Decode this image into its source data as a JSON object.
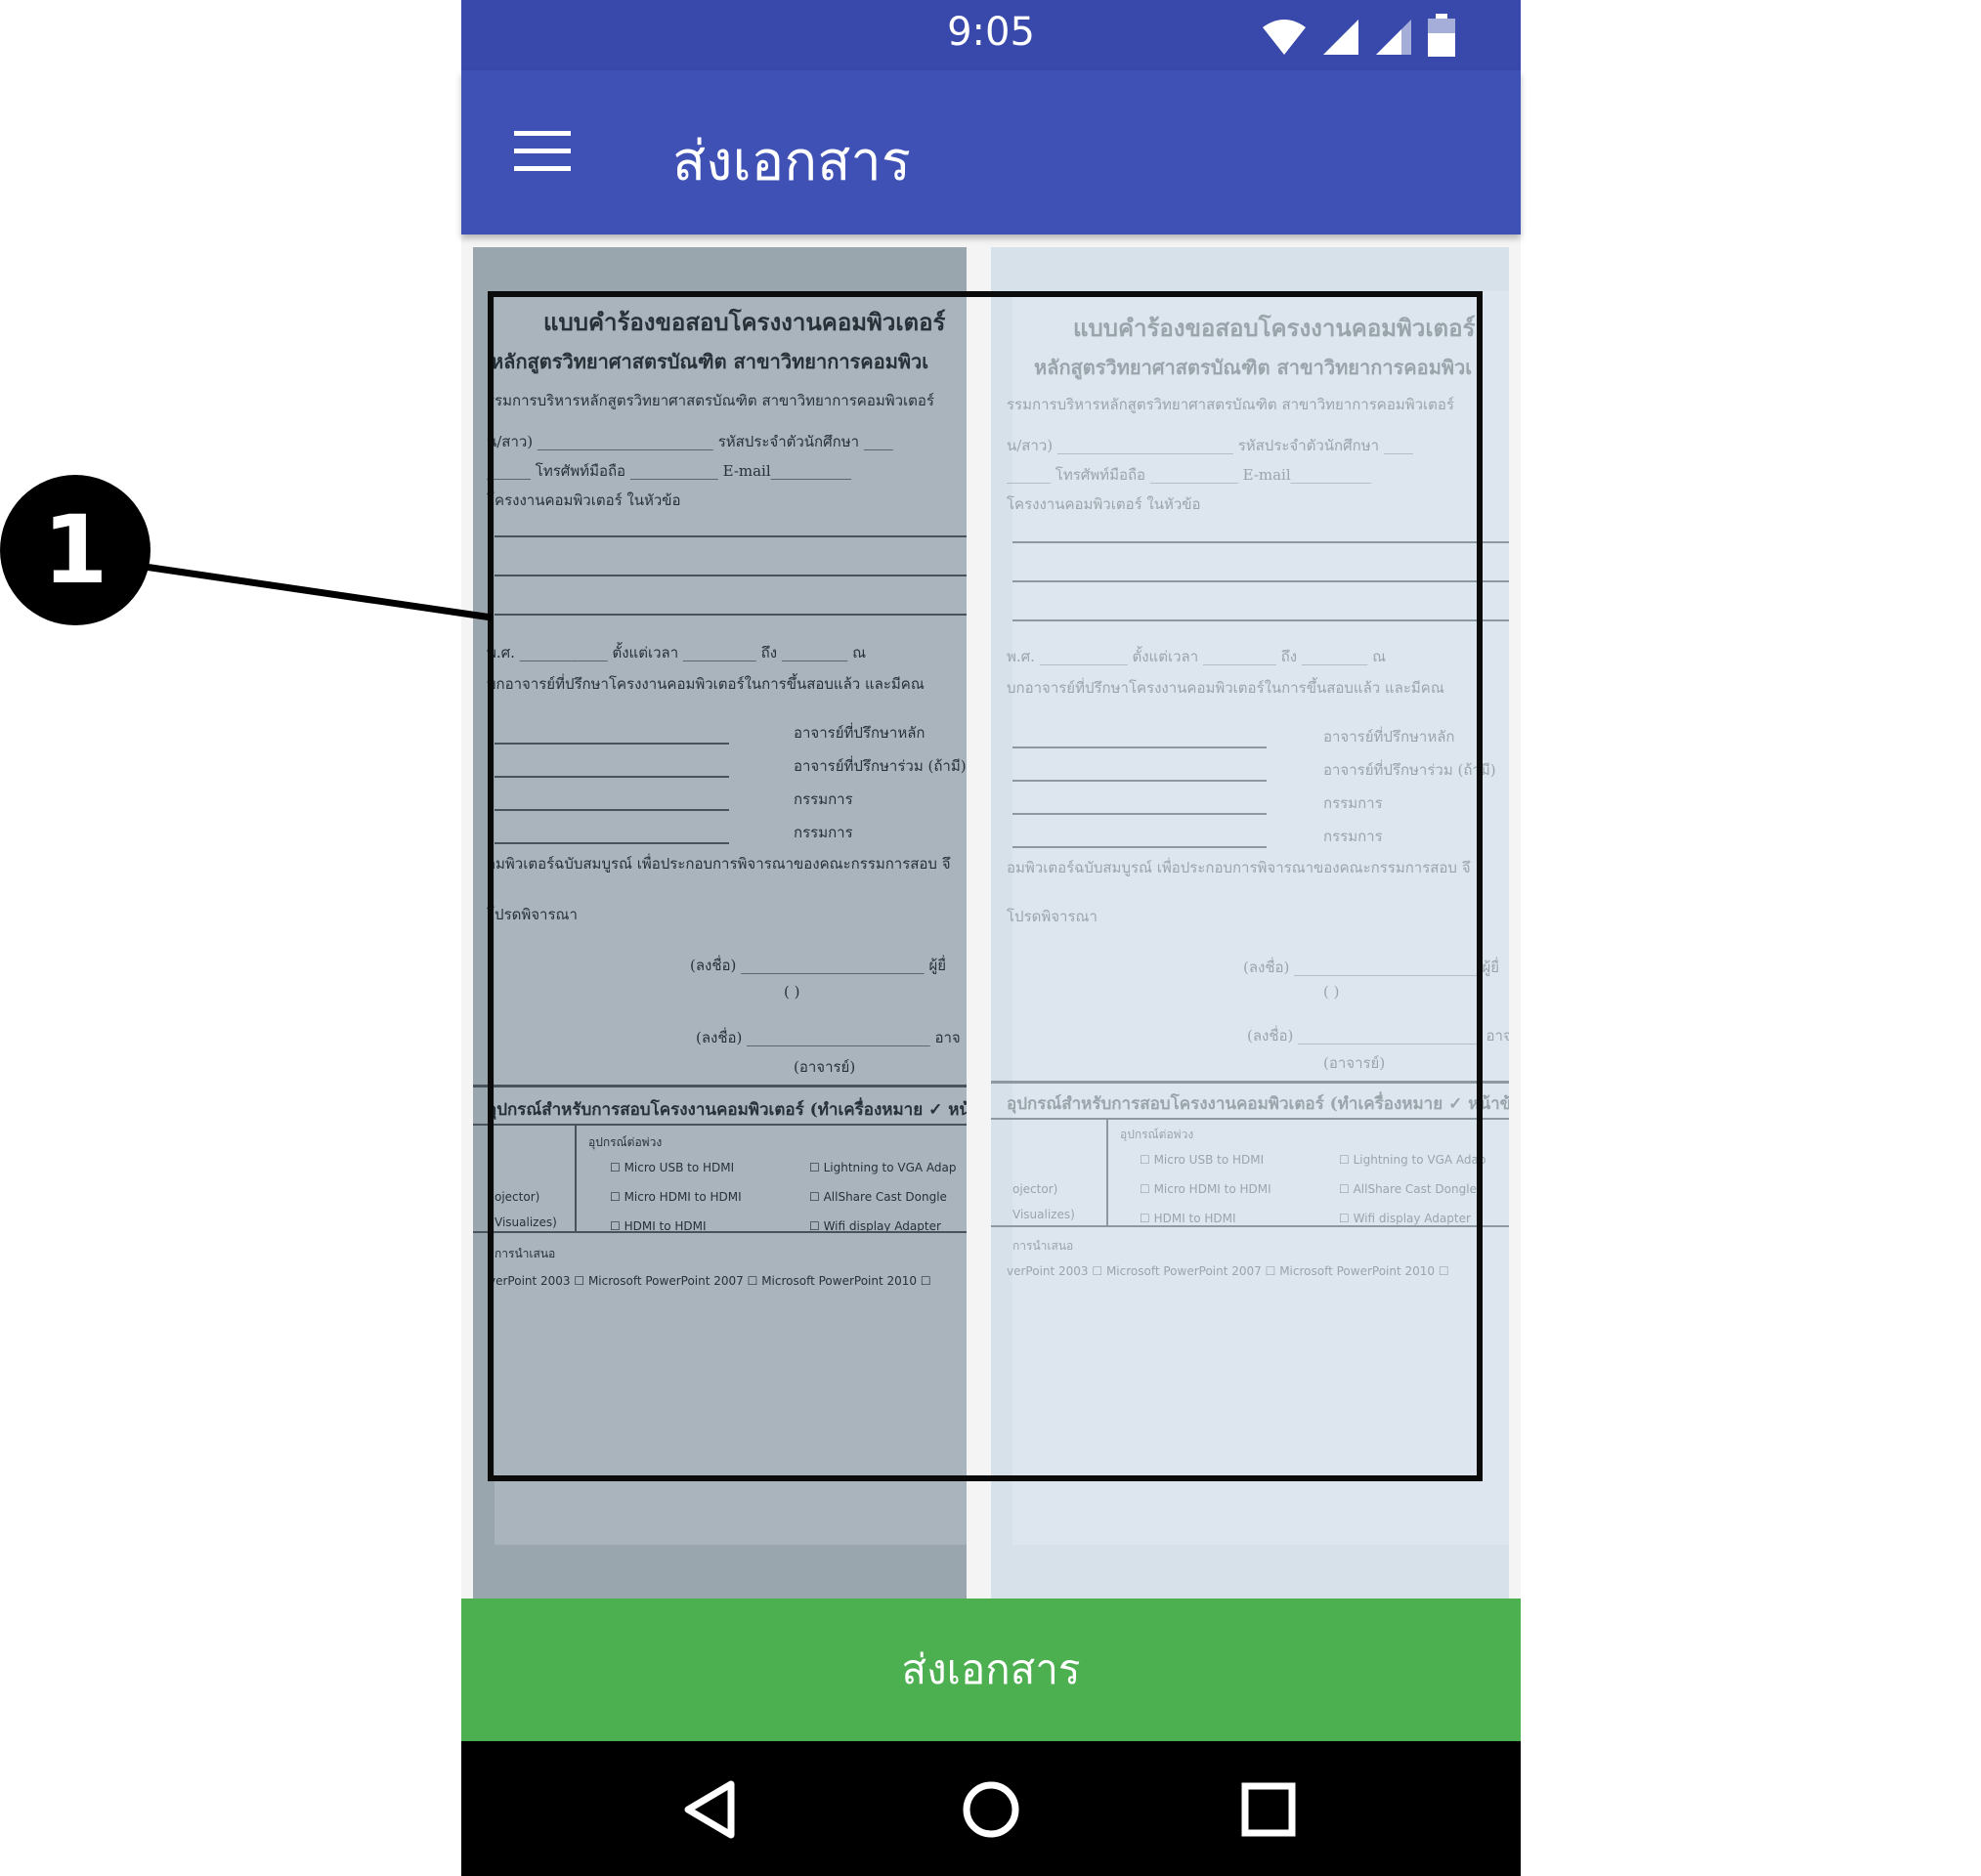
{
  "status_bar": {
    "time": "9:05",
    "icons": [
      "wifi-icon",
      "signal-icon",
      "signal-icon",
      "battery-icon"
    ]
  },
  "app_bar": {
    "menu_icon": "hamburger-menu-icon",
    "title": "ส่งเอกสาร"
  },
  "callout": {
    "number": "1"
  },
  "send_button": {
    "label": "ส่งเอกสาร",
    "color": "#4caf50"
  },
  "nav_bar": {
    "back_icon": "back-triangle-icon",
    "home_icon": "home-circle-icon",
    "recents_icon": "recents-square-icon"
  },
  "colors": {
    "status_bar": "#3949ab",
    "app_bar": "#3f51b5",
    "nav_bar": "#000000"
  },
  "document": {
    "title": "แบบคำร้องขอสอบโครงงานคอมพิวเตอร์",
    "subtitle": "หลักสูตรวิทยาศาสตรบัณฑิต สาขาวิทยาการคอมพิวเ",
    "line1": "รรมการบริหารหลักสูตรวิทยาศาสตรบัณฑิต สาขาวิทยาการคอมพิวเตอร์",
    "line2": "น/สาว) ________________________ รหัสประจำตัวนักศึกษา ____",
    "line3": "______ โทรศัพท์มือถือ ____________ E-mail___________",
    "line4": "โครงงานคอมพิวเตอร์ ในหัวข้อ",
    "line5": "พ.ศ. ____________ ตั้งแต่เวลา __________ ถึง _________ ณ",
    "line6": "บกอาจารย์ที่ปรึกษาโครงงานคอมพิวเตอร์ในการขึ้นสอบแล้ว และมีคณ",
    "advisor_main": "อาจารย์ที่ปรึกษาหลัก",
    "advisor_co": "อาจารย์ที่ปรึกษาร่วม (ถ้ามี)",
    "committee1": "กรรมการ",
    "committee2": "กรรมการ",
    "line7": "อมพิวเตอร์ฉบับสมบูรณ์ เพื่อประกอบการพิจารณาของคณะกรรมการสอบ จึ",
    "line8": "โปรดพิจารณา",
    "sign1": "(ลงชื่อ) _________________________ ผู้ยื่",
    "sign1_paren": "(                                          )",
    "sign2": "(ลงชื่อ) _________________________ อาจ",
    "sign2_role": "(อาจารย์)",
    "equipment_title": "อุปกรณ์สำหรับการสอบโครงงานคอมพิวเตอร์ (ทำเครื่องหมาย ✓ หน้าข้",
    "adapters_label": "อุปกรณ์ต่อพ่วง",
    "opt1": "☐ Micro USB to HDMI",
    "opt2": "☐ Micro HDMI to HDMI",
    "opt3": "☐ HDMI to HDMI",
    "opt4": "☐ Lightning to VGA Adap",
    "opt5": "☐ AllShare Cast Dongle",
    "opt6": "☐ Wifi display Adapter",
    "projector": "ojector)",
    "visualizer": "Visualizes)",
    "present_label": "การนำเสนอ",
    "present_opts": "verPoint 2003  ☐ Microsoft PowerPoint 2007  ☐ Microsoft PowerPoint 2010  ☐"
  }
}
